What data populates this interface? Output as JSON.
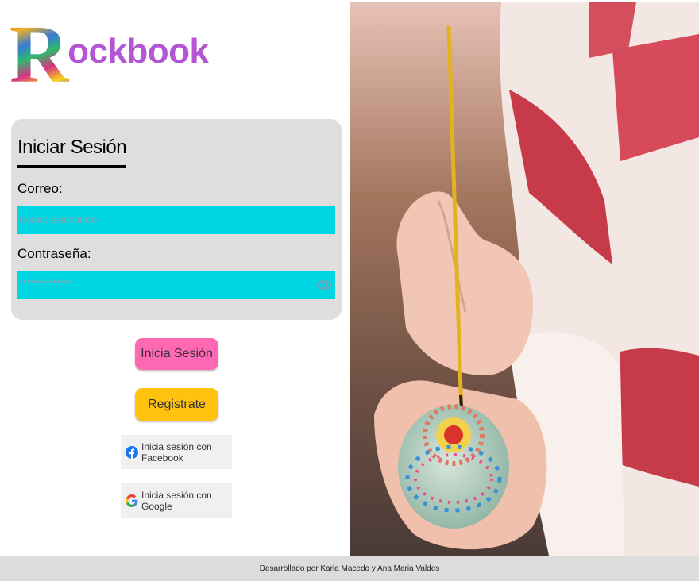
{
  "brand": {
    "initial": "R",
    "rest": "ockbook"
  },
  "login": {
    "title": "Iniciar Sesión",
    "email_label": "Correo:",
    "email_placeholder": "Correo electronico",
    "password_label": "Contraseña:",
    "password_placeholder": "**************"
  },
  "buttons": {
    "login": "Inicia Sesión",
    "register": "Registrate",
    "facebook": "Inicia sesión con Facebook",
    "google": "Inicia sesión con Google"
  },
  "footer": {
    "text": "Desarrollado por Karla Macedo y Ana Maria Valdes"
  },
  "colors": {
    "field": "#00d5e3",
    "login_button": "#ff69b4",
    "register_button": "#ffc20e",
    "brand_text": "#b455d6",
    "card": "#dedede"
  },
  "icons": [
    "eye-icon",
    "facebook-icon",
    "google-icon"
  ]
}
